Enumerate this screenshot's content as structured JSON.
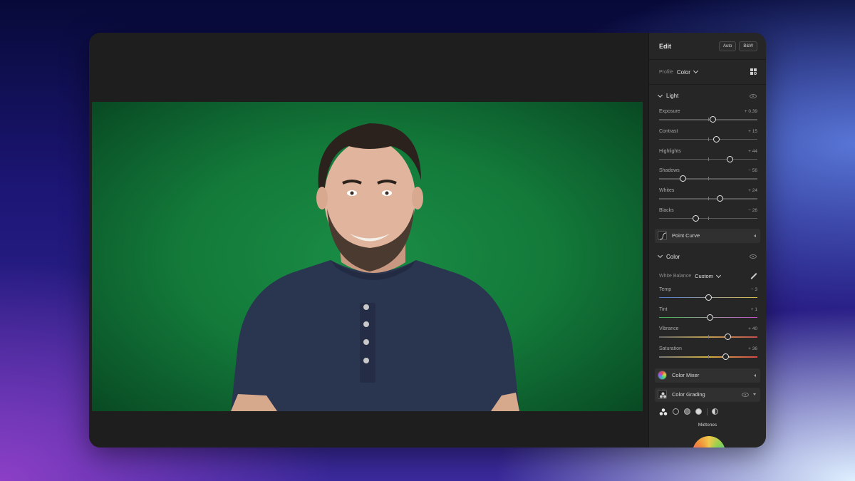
{
  "panel": {
    "title": "Edit",
    "auto_label": "Auto",
    "bw_label": "B&W",
    "profile_label": "Profile",
    "profile_value": "Color"
  },
  "light": {
    "title": "Light",
    "sliders": [
      {
        "label": "Exposure",
        "value": "+ 0.39",
        "position": 0.55
      },
      {
        "label": "Contrast",
        "value": "+ 15",
        "position": 0.585
      },
      {
        "label": "Highlights",
        "value": "+ 44",
        "position": 0.72
      },
      {
        "label": "Shadows",
        "value": "− 56",
        "position": 0.24
      },
      {
        "label": "Whites",
        "value": "+ 24",
        "position": 0.62
      },
      {
        "label": "Blacks",
        "value": "− 26",
        "position": 0.37
      }
    ],
    "point_curve_label": "Point Curve"
  },
  "color": {
    "title": "Color",
    "white_balance_label": "White Balance",
    "white_balance_value": "Custom",
    "sliders": [
      {
        "label": "Temp",
        "value": "− 3",
        "position": 0.5
      },
      {
        "label": "Tint",
        "value": "+ 1",
        "position": 0.52
      },
      {
        "label": "Vibrance",
        "value": "+ 40",
        "position": 0.7
      },
      {
        "label": "Saturation",
        "value": "+ 36",
        "position": 0.68
      }
    ],
    "color_mixer_label": "Color Mixer"
  },
  "color_grading": {
    "title": "Color Grading",
    "midtones_label": "Midtones"
  },
  "colors": {
    "green_screen": "#137a3a",
    "panel_bg": "#262626",
    "canvas_bg": "#1e1e1e"
  }
}
